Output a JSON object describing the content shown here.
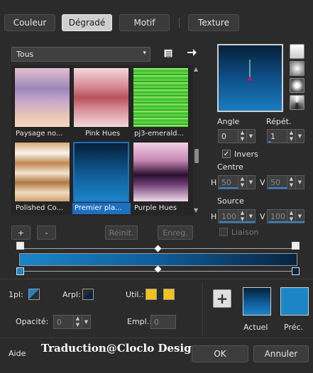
{
  "tabs": [
    {
      "label": "Couleur",
      "active": false
    },
    {
      "label": "Dégradé",
      "active": true
    },
    {
      "label": "Motif",
      "active": false
    },
    {
      "label": "Texture",
      "active": false
    }
  ],
  "category_dropdown": {
    "value": "Tous"
  },
  "gradients": [
    {
      "label": "Paysage no...",
      "selected": false
    },
    {
      "label": "Pink Hues",
      "selected": false
    },
    {
      "label": "pj3-emerald...",
      "selected": false
    },
    {
      "label": "Polished Co...",
      "selected": false
    },
    {
      "label": "Premier pla...",
      "selected": true
    },
    {
      "label": "Purple Hues",
      "selected": false
    }
  ],
  "gallery_buttons": {
    "add": "+",
    "remove": "-",
    "reset": "Réinit.",
    "save": "Enreg."
  },
  "angle": {
    "label": "Angle",
    "value": "0"
  },
  "repeat": {
    "label": "Répét.",
    "value": "1"
  },
  "invert": {
    "label": "Invers",
    "checked": true
  },
  "center": {
    "label": "Centre",
    "h_label": "H",
    "h_value": "50",
    "v_label": "V",
    "v_value": "50"
  },
  "source": {
    "label": "Source",
    "h_label": "H",
    "h_value": "100",
    "v_label": "V",
    "v_value": "100"
  },
  "link": {
    "label": "Liaison",
    "checked": false
  },
  "stops": {
    "first_label": "1pl:",
    "back_label": "Arpl:",
    "user_label": "Util.:",
    "opacity_label": "Opacité:",
    "opacity_value": "0",
    "location_label": "Empl.:",
    "location_value": "0"
  },
  "current_label": "Actuel",
  "previous_label": "Préc.",
  "help_label": "Aide",
  "credit": "Traduction@Cloclo Design",
  "ok_label": "OK",
  "cancel_label": "Annuler",
  "colors": {
    "accent": "#1f6fbf",
    "user_color": "#f4c21b",
    "gradient_light": "#1b85c7",
    "gradient_dark": "#072440"
  }
}
